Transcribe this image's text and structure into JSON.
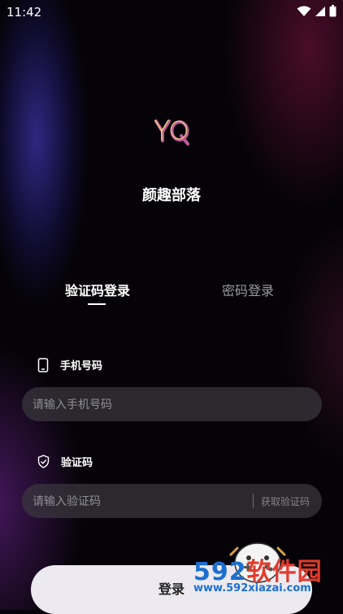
{
  "status_bar": {
    "time": "11:42"
  },
  "app": {
    "name": "颜趣部落"
  },
  "tabs": [
    {
      "label": "验证码登录",
      "active": true
    },
    {
      "label": "密码登录",
      "active": false
    }
  ],
  "phone_field": {
    "label": "手机号码",
    "placeholder": "请输入手机号码",
    "value": ""
  },
  "code_field": {
    "label": "验证码",
    "placeholder": "请输入验证码",
    "value": "",
    "get_code_label": "获取验证码"
  },
  "login_button": {
    "label": "登录"
  },
  "watermark": {
    "brand_num": "592",
    "brand_text": "软件园",
    "url": "www.592xiazai.com"
  },
  "colors": {
    "accent_pink": "#c05a9a",
    "logo_yellow": "#e8d27a",
    "input_bg": "#3a383e",
    "button_bg": "#eceaf0"
  },
  "icons": [
    "signal-icon",
    "wifi-icon",
    "battery-icon",
    "phone-icon",
    "shield-icon"
  ]
}
